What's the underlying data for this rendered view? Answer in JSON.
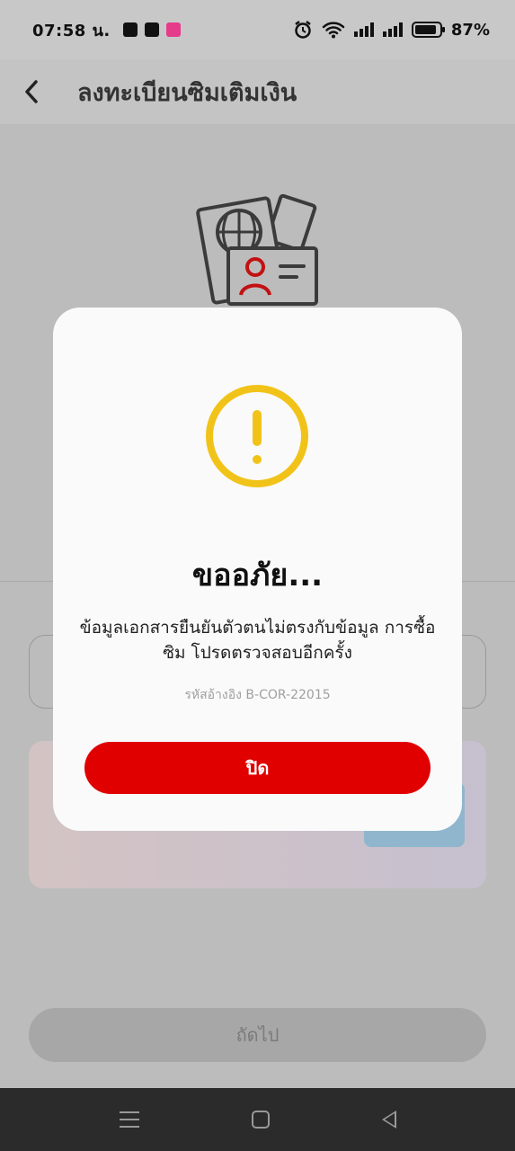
{
  "status_bar": {
    "time": "07:58 น.",
    "battery": "87%",
    "battery_level": 0.87,
    "icons": [
      "shopee-icon",
      "app-icon",
      "pink-app-icon",
      "alarm-icon",
      "wifi-icon",
      "signal-icon",
      "signal-icon",
      "battery-icon"
    ]
  },
  "header": {
    "title": "ลงทะเบียนซิมเติมเงิน",
    "back_icon": "chevron-left-icon"
  },
  "background": {
    "illustration": "passport-id-card-illustration",
    "next_button_label": "ถัดไป"
  },
  "modal": {
    "icon": "warning-icon",
    "icon_color": "#f1c318",
    "title": "ขออภัย...",
    "message": "ข้อมูลเอกสารยืนยันตัวตนไม่ตรงกับข้อมูล การซื้อซิม โปรดตรวจสอบอีกครั้ง",
    "reference": "รหัสอ้างอิง B-COR-22015",
    "close_label": "ปิด",
    "close_color": "#e00000"
  },
  "nav_bar": {
    "icons": [
      "menu-icon",
      "home-icon",
      "back-icon"
    ]
  }
}
